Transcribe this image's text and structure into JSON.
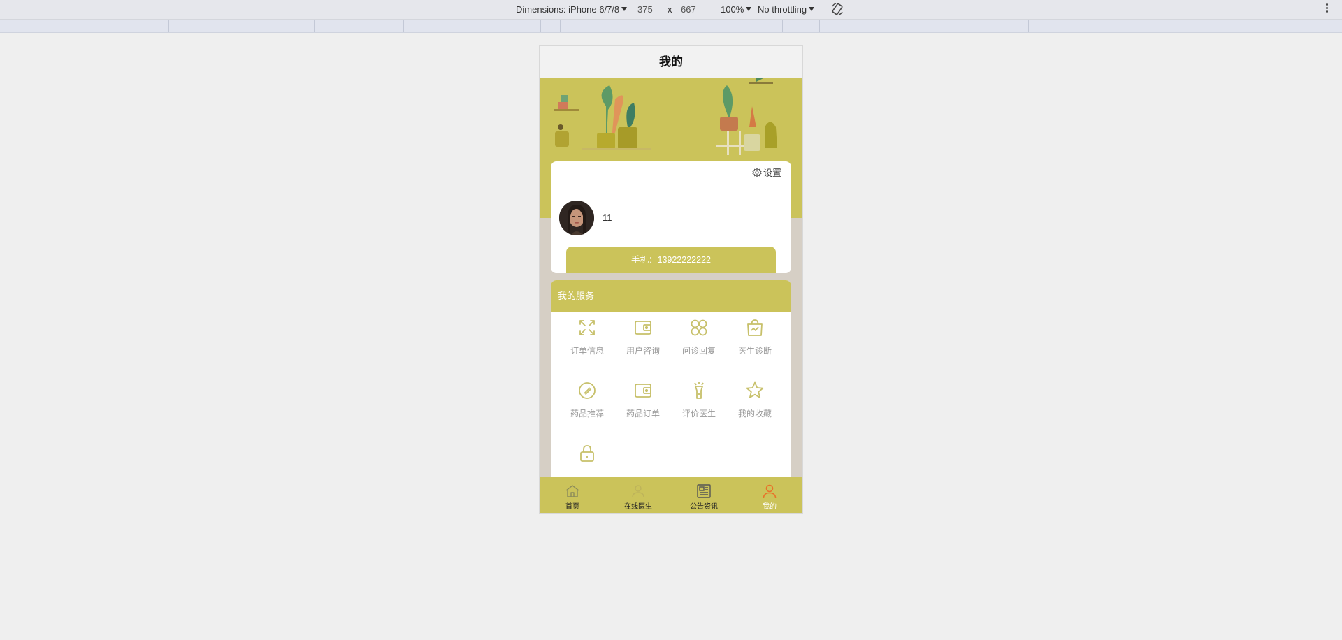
{
  "devtools": {
    "dimensions_label": "Dimensions: iPhone 6/7/8",
    "width": "375",
    "times": "x",
    "height": "667",
    "zoom": "100%",
    "throttling": "No throttling"
  },
  "page": {
    "title": "我的",
    "settings_label": "设置",
    "username": "11",
    "phone_label": "手机：13922222222"
  },
  "services": {
    "title": "我的服务",
    "items": [
      {
        "label": "订单信息",
        "icon": "expand-icon"
      },
      {
        "label": "用户咨询",
        "icon": "wallet-icon"
      },
      {
        "label": "问诊回复",
        "icon": "apps-icon"
      },
      {
        "label": "医生诊断",
        "icon": "bag-icon"
      },
      {
        "label": "药品推荐",
        "icon": "compass-icon"
      },
      {
        "label": "药品订单",
        "icon": "wallet-icon"
      },
      {
        "label": "评价医生",
        "icon": "flashlight-icon"
      },
      {
        "label": "我的收藏",
        "icon": "star-icon"
      },
      {
        "label": "",
        "icon": "lock-icon"
      }
    ]
  },
  "tabbar": {
    "items": [
      {
        "label": "首页",
        "icon": "home-icon"
      },
      {
        "label": "在线医生",
        "icon": "doctor-icon"
      },
      {
        "label": "公告资讯",
        "icon": "news-icon"
      },
      {
        "label": "我的",
        "icon": "user-icon"
      }
    ]
  },
  "colors": {
    "accent": "#cbc35a",
    "icon": "#c7c06a",
    "active_tab": "#e8732a"
  }
}
